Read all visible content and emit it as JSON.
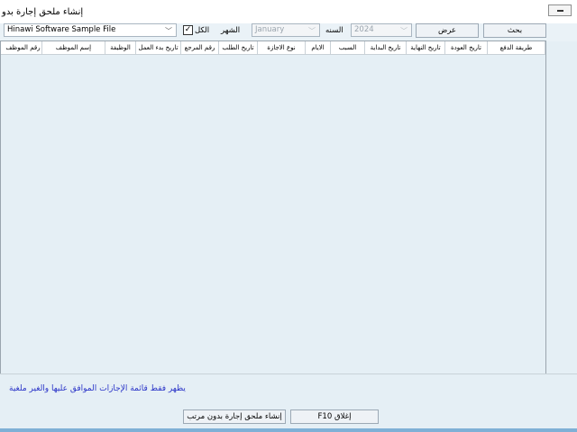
{
  "window": {
    "title": "إنشاء ملحق إجارة بدو"
  },
  "toolbar": {
    "company_value": "Hinawi Software Sample File",
    "all_label": "الكل",
    "all_checked": "✓",
    "month_label": "الشهر",
    "month_value": "January",
    "year_label": "السنه",
    "year_value": "2024",
    "view_button": "عرض",
    "search_button": "بحث"
  },
  "grid": {
    "columns": [
      "طريقة الدفع",
      "تاريخ العودة",
      "تاريخ النهاية",
      "تاريخ البداية",
      "السبب",
      "الايام",
      "نوع الاجازة",
      "تاريخ الطلب",
      "رقم المرجع",
      "تاريخ بدء العمل",
      "الوظيفة",
      "إسم الموظف",
      "رقم الموظف"
    ]
  },
  "footer": {
    "note": "يظهر فقط قائمة الإجازات الموافق عليها والغير ملغية",
    "create_button": "إنشاء ملحق إجارة بدون مرتب",
    "close_button": "F10 إغلاق"
  }
}
